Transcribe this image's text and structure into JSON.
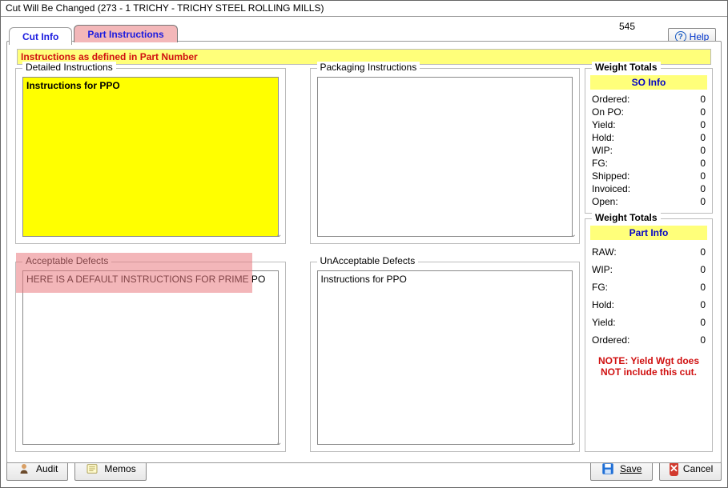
{
  "window_title": "Cut Will Be Changed  (273 - 1  TRICHY - TRICHY STEEL ROLLING MILLS)",
  "top_number": "545",
  "help_label": "Help",
  "tabs": {
    "cut_info": "Cut Info",
    "part_instructions": "Part Instructions"
  },
  "banner": "Instructions as defined in Part Number",
  "fields": {
    "detailed": {
      "legend": "Detailed Instructions",
      "value": "Instructions for PPO"
    },
    "packaging": {
      "legend": "Packaging Instructions",
      "value": ""
    },
    "acceptable": {
      "legend": "Acceptable Defects",
      "value": "HERE IS A DEFAULT INSTRUCTIONS FOR PRIME PO"
    },
    "unacceptable": {
      "legend": "UnAcceptable Defects",
      "value": "Instructions for PPO"
    }
  },
  "so_box": {
    "group": "Weight Totals",
    "header": "SO Info",
    "rows": [
      {
        "label": "Ordered:",
        "value": "0"
      },
      {
        "label": "On PO:",
        "value": "0"
      },
      {
        "label": "Yield:",
        "value": "0"
      },
      {
        "label": "Hold:",
        "value": "0"
      },
      {
        "label": "WIP:",
        "value": "0"
      },
      {
        "label": "FG:",
        "value": "0"
      },
      {
        "label": "Shipped:",
        "value": "0"
      },
      {
        "label": "Invoiced:",
        "value": "0"
      },
      {
        "label": "Open:",
        "value": "0"
      }
    ]
  },
  "part_box": {
    "group": "Weight Totals",
    "header": "Part Info",
    "rows": [
      {
        "label": "RAW:",
        "value": "0"
      },
      {
        "label": "WIP:",
        "value": "0"
      },
      {
        "label": "FG:",
        "value": "0"
      },
      {
        "label": "Hold:",
        "value": "0"
      },
      {
        "label": "Yield:",
        "value": "0"
      },
      {
        "label": "Ordered:",
        "value": "0"
      }
    ],
    "note": "NOTE: Yield Wgt does NOT include this cut."
  },
  "footer": {
    "audit": "Audit",
    "memos": "Memos",
    "save": "Save",
    "cancel": "Cancel"
  }
}
